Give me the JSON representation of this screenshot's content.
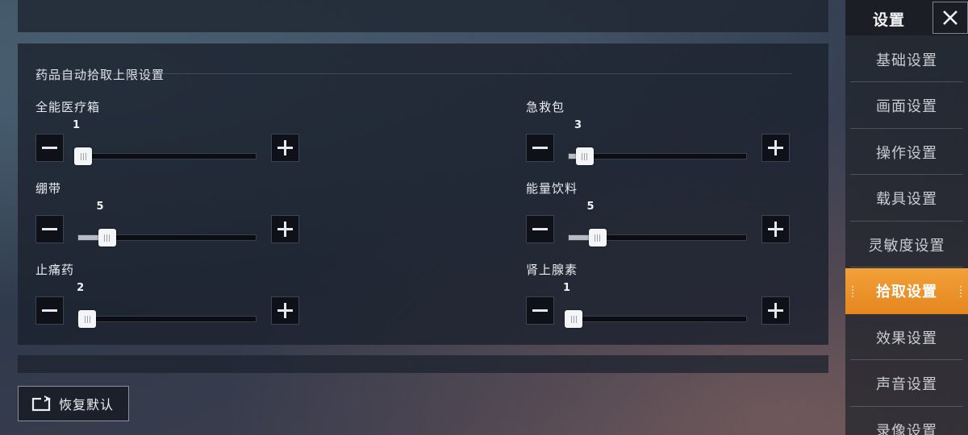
{
  "main": {
    "section_title": "药品自动拾取上限设置",
    "sliders": [
      {
        "label": "全能医疗箱",
        "value": "1",
        "fraction": 0.02
      },
      {
        "label": "急救包",
        "value": "3",
        "fraction": 0.09
      },
      {
        "label": "绷带",
        "value": "5",
        "fraction": 0.16
      },
      {
        "label": "能量饮料",
        "value": "5",
        "fraction": 0.16
      },
      {
        "label": "止痛药",
        "value": "2",
        "fraction": 0.05
      },
      {
        "label": "肾上腺素",
        "value": "1",
        "fraction": 0.02
      }
    ]
  },
  "footer": {
    "reset_label": "恢复默认"
  },
  "sidebar": {
    "title": "设置",
    "items": [
      {
        "label": "基础设置"
      },
      {
        "label": "画面设置"
      },
      {
        "label": "操作设置"
      },
      {
        "label": "载具设置"
      },
      {
        "label": "灵敏度设置"
      },
      {
        "label": "拾取设置"
      },
      {
        "label": "效果设置"
      },
      {
        "label": "声音设置"
      },
      {
        "label": "录像设置"
      }
    ],
    "active_index": 5
  },
  "colors": {
    "accent": "#f2a13a",
    "panel": "#1c222e"
  },
  "icons": {
    "close": "close-icon",
    "reset": "reset-icon",
    "minus": "minus-icon",
    "plus": "plus-icon"
  }
}
